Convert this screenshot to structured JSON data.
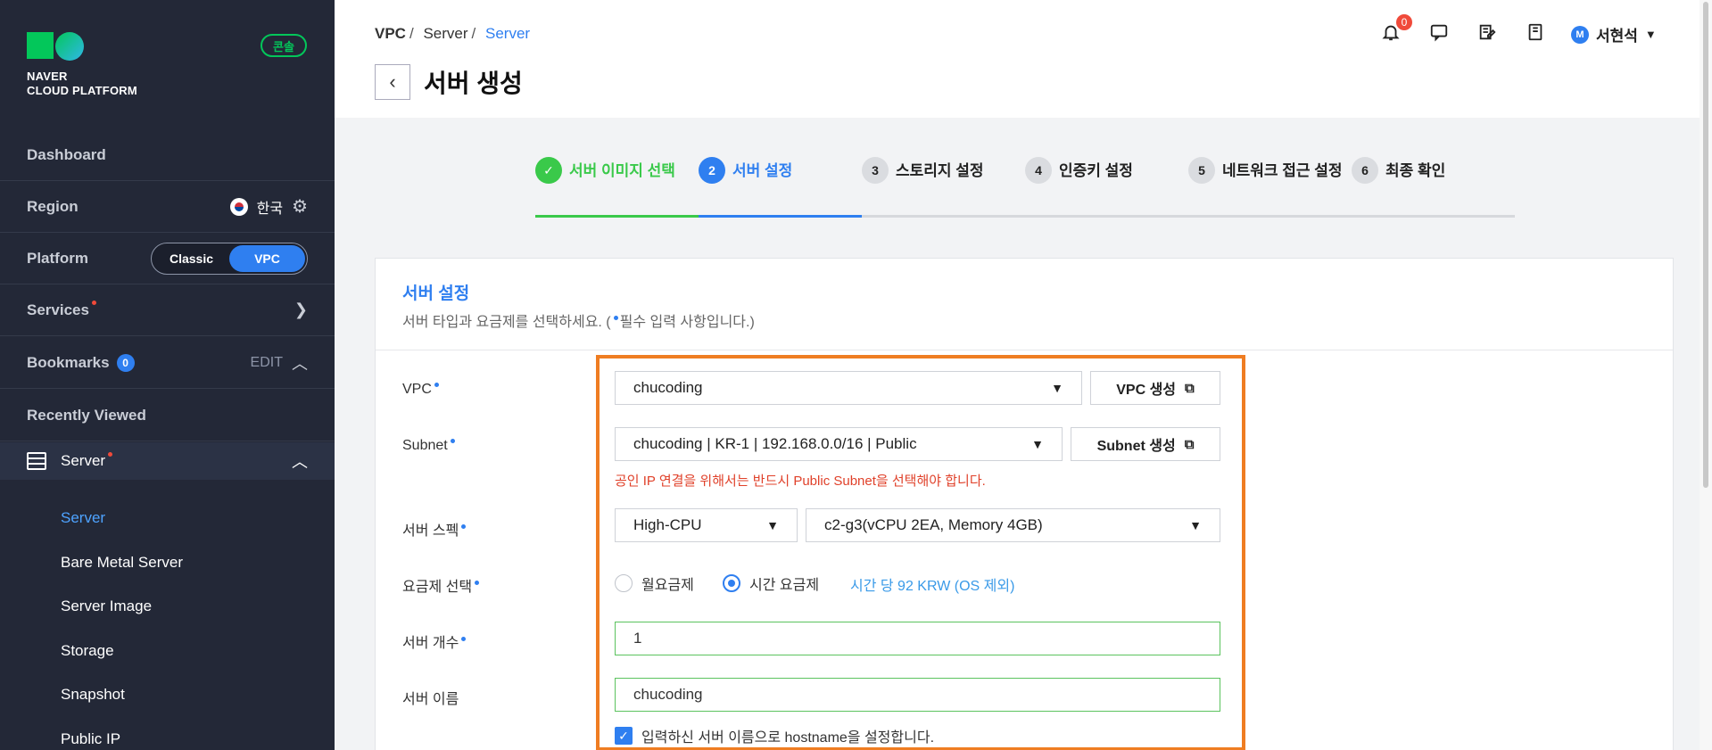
{
  "sidebar": {
    "logo_line1": "NAVER",
    "logo_line2": "CLOUD PLATFORM",
    "console_label": "콘솔",
    "dashboard": "Dashboard",
    "region_label": "Region",
    "region_value": "한국",
    "platform_label": "Platform",
    "platform_classic": "Classic",
    "platform_vpc": "VPC",
    "services": "Services",
    "bookmarks": "Bookmarks",
    "bookmarks_count": "0",
    "edit": "EDIT",
    "recently_viewed": "Recently Viewed",
    "server_group": "Server",
    "sub_items": [
      "Server",
      "Bare Metal Server",
      "Server Image",
      "Storage",
      "Snapshot",
      "Public IP"
    ]
  },
  "header": {
    "breadcrumb": [
      "VPC",
      "Server",
      "Server"
    ],
    "title": "서버 생성",
    "notification_count": "0",
    "user_initial": "M",
    "user_name": "서현석",
    "icons": [
      "bell-icon",
      "chat-icon",
      "memo-icon",
      "manual-icon"
    ]
  },
  "steps": [
    {
      "num": "✓",
      "label": "서버 이미지 선택",
      "state": "done"
    },
    {
      "num": "2",
      "label": "서버 설정",
      "state": "active"
    },
    {
      "num": "3",
      "label": "스토리지 설정",
      "state": "pending"
    },
    {
      "num": "4",
      "label": "인증키 설정",
      "state": "pending"
    },
    {
      "num": "5",
      "label": "네트워크 접근 설정",
      "state": "pending"
    },
    {
      "num": "6",
      "label": "최종 확인",
      "state": "pending"
    }
  ],
  "card": {
    "title": "서버 설정",
    "desc_before": "서버 타입과 요금제를 선택하세요. (",
    "desc_after": "필수 입력 사항입니다.)"
  },
  "form": {
    "vpc_label": "VPC",
    "vpc_value": "chucoding",
    "vpc_button": "VPC 생성",
    "subnet_label": "Subnet",
    "subnet_value": "chucoding | KR-1 | 192.168.0.0/16 | Public",
    "subnet_button": "Subnet 생성",
    "subnet_warning": "공인 IP 연결을 위해서는 반드시 Public Subnet을 선택해야 합니다.",
    "spec_label": "서버 스펙",
    "spec_type": "High-CPU",
    "spec_value": "c2-g3(vCPU 2EA, Memory 4GB)",
    "pricing_label": "요금제 선택",
    "pricing_monthly": "월요금제",
    "pricing_hourly": "시간 요금제",
    "pricing_note": "시간 당 92 KRW (OS 제외)",
    "count_label": "서버 개수",
    "count_value": "1",
    "name_label": "서버 이름",
    "name_value": "chucoding",
    "hostname_check": "입력하신 서버 이름으로 hostname을 설정합니다."
  },
  "colors": {
    "accent": "#2f7ff0",
    "success": "#3ac94a",
    "warning": "#e0412a",
    "highlight": "#ef7d22",
    "sidebar_bg": "#232837"
  }
}
